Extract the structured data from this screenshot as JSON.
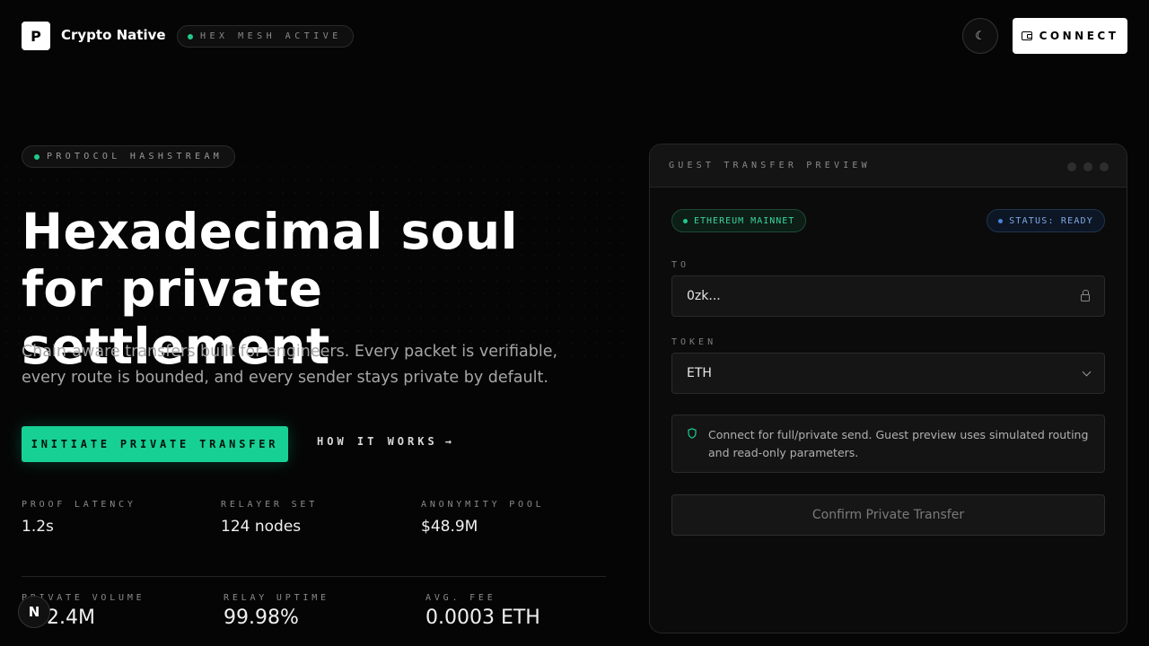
{
  "header": {
    "logo_letter": "P",
    "brand": "Crypto Native",
    "mesh_status": "HEX MESH ACTIVE",
    "theme_toggle_icon": "☾",
    "connect_label": "CONNECT"
  },
  "hero": {
    "badge": "PROTOCOL HASHSTREAM",
    "title": "Hexadecimal soul for private settlement",
    "subtitle": "Chain-aware transfers built for engineers. Every packet is verifiable, every route is bounded, and every sender stays private by default.",
    "cta_primary": "INITIATE PRIVATE TRANSFER",
    "cta_secondary": "HOW IT WORKS",
    "cta_secondary_arrow": "→"
  },
  "stats_row1": [
    {
      "label": "PROOF LATENCY",
      "value": "1.2s"
    },
    {
      "label": "RELAYER SET",
      "value": "124 nodes"
    },
    {
      "label": "ANONYMITY POOL",
      "value": "$48.9M"
    }
  ],
  "stats_row2": [
    {
      "label": "PRIVATE VOLUME",
      "value": "$12.4M"
    },
    {
      "label": "RELAY UPTIME",
      "value": "99.98%"
    },
    {
      "label": "AVG. FEE",
      "value": "0.0003 ETH"
    }
  ],
  "floating_badge": "N",
  "card": {
    "title": "GUEST TRANSFER PREVIEW",
    "network": "ETHEREUM MAINNET",
    "status": "STATUS: READY",
    "to_label": "TO",
    "to_value": "0zk...",
    "token_label": "TOKEN",
    "token_value": "ETH",
    "notice": "Connect for full/private send. Guest preview uses simulated routing and read-only parameters.",
    "confirm_label": "Confirm Private Transfer"
  },
  "colors": {
    "accent": "#17d194",
    "background": "#050505",
    "status_blue": "#4b84d9"
  }
}
